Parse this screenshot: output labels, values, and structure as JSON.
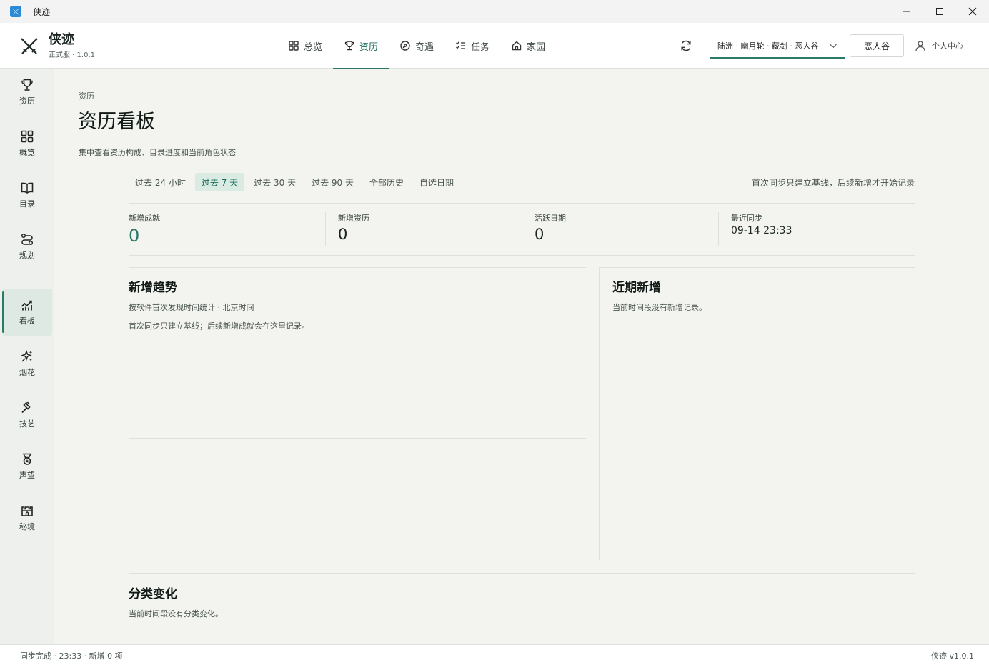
{
  "window": {
    "title": "侠迹"
  },
  "brand": {
    "name": "侠迹",
    "version": "正式服 · 1.0.1"
  },
  "topnav": [
    {
      "label": "总览",
      "icon": "grid-icon"
    },
    {
      "label": "资历",
      "icon": "trophy-icon",
      "active": true
    },
    {
      "label": "奇遇",
      "icon": "compass-icon"
    },
    {
      "label": "任务",
      "icon": "checklist-icon"
    },
    {
      "label": "家园",
      "icon": "home-icon"
    }
  ],
  "header": {
    "server": "陆洲 · 幽月轮 · 藏剑 · 恶人谷",
    "realm_button": "恶人谷",
    "user_center": "个人中心"
  },
  "sidebar": [
    {
      "label": "资历",
      "icon": "trophy-icon"
    },
    {
      "label": "概览",
      "icon": "grid-icon"
    },
    {
      "label": "目录",
      "icon": "book-icon"
    },
    {
      "label": "规划",
      "icon": "route-icon"
    },
    {
      "label": "看板",
      "icon": "chart-icon",
      "active": true
    },
    {
      "label": "烟花",
      "icon": "sparkle-icon"
    },
    {
      "label": "技艺",
      "icon": "hammer-icon"
    },
    {
      "label": "声望",
      "icon": "medal-icon"
    },
    {
      "label": "秘境",
      "icon": "castle-icon"
    }
  ],
  "page": {
    "breadcrumb": "资历",
    "title": "资历看板",
    "description": "集中查看资历构成、目录进度和当前角色状态"
  },
  "range_tabs": [
    "过去 24 小时",
    "过去 7 天",
    "过去 30 天",
    "过去 90 天",
    "全部历史",
    "自选日期"
  ],
  "range_active": "过去 7 天",
  "range_note": "首次同步只建立基线，后续新增才开始记录",
  "stats": [
    {
      "label": "新增成就",
      "value": "0"
    },
    {
      "label": "新增资历",
      "value": "0"
    },
    {
      "label": "活跃日期",
      "value": "0"
    },
    {
      "label": "最近同步",
      "value": "09-14 23:33"
    }
  ],
  "trend": {
    "title": "新增趋势",
    "subtitle": "按软件首次发现时间统计 · 北京时间",
    "note": "首次同步只建立基线；后续新增成就会在这里记录。"
  },
  "recent": {
    "title": "近期新增",
    "empty": "当前时间段没有新增记录。"
  },
  "category": {
    "title": "分类变化",
    "empty": "当前时间段没有分类变化。"
  },
  "status": {
    "left": "同步完成 · 23:33 · 新增 0 项",
    "right": "侠迹 v1.0.1"
  },
  "colors": {
    "accent": "#2b7a68",
    "accent_bg": "#d9ebe3",
    "app_icon": "#2a8ad8"
  }
}
